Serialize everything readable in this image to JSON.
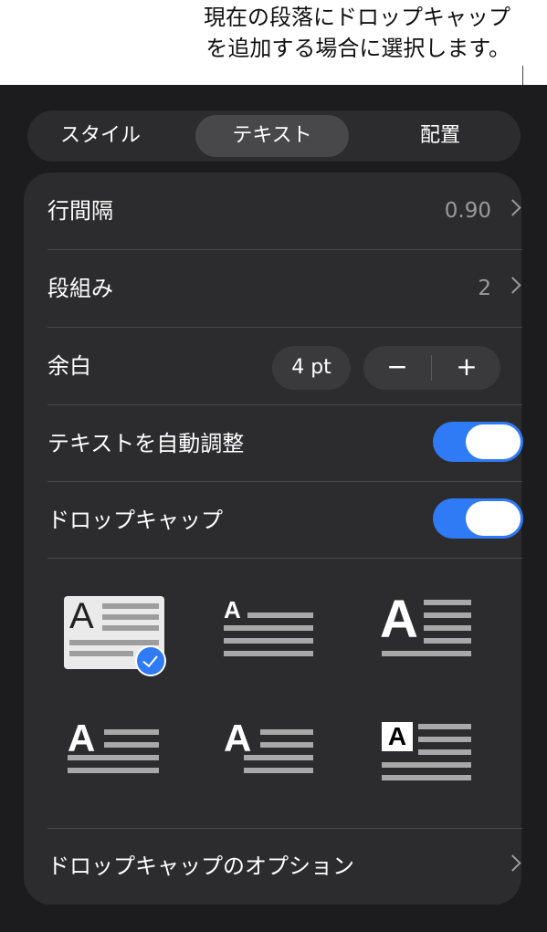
{
  "callout": {
    "line1": "現在の段落にドロップキャップ",
    "line2": "を追加する場合に選択します。"
  },
  "tabs": [
    {
      "label": "スタイル",
      "active": false
    },
    {
      "label": "テキスト",
      "active": true
    },
    {
      "label": "配置",
      "active": false
    }
  ],
  "rows": {
    "line_spacing": {
      "label": "行間隔",
      "value": "0.90"
    },
    "columns": {
      "label": "段組み",
      "value": "2"
    },
    "margin": {
      "label": "余白",
      "value": "4 pt",
      "minus": "−",
      "plus": "+"
    },
    "autofit": {
      "label": "テキストを自動調整",
      "on": true
    },
    "drop_cap": {
      "label": "ドロップキャップ",
      "on": true
    }
  },
  "drop_cap_styles": {
    "glyph": "A",
    "selected_index": 0,
    "count": 6
  },
  "options": {
    "label": "ドロップキャップのオプション"
  },
  "colors": {
    "accent": "#2f7bf6",
    "panel": "#1c1c1e",
    "card": "#2c2c2e"
  }
}
